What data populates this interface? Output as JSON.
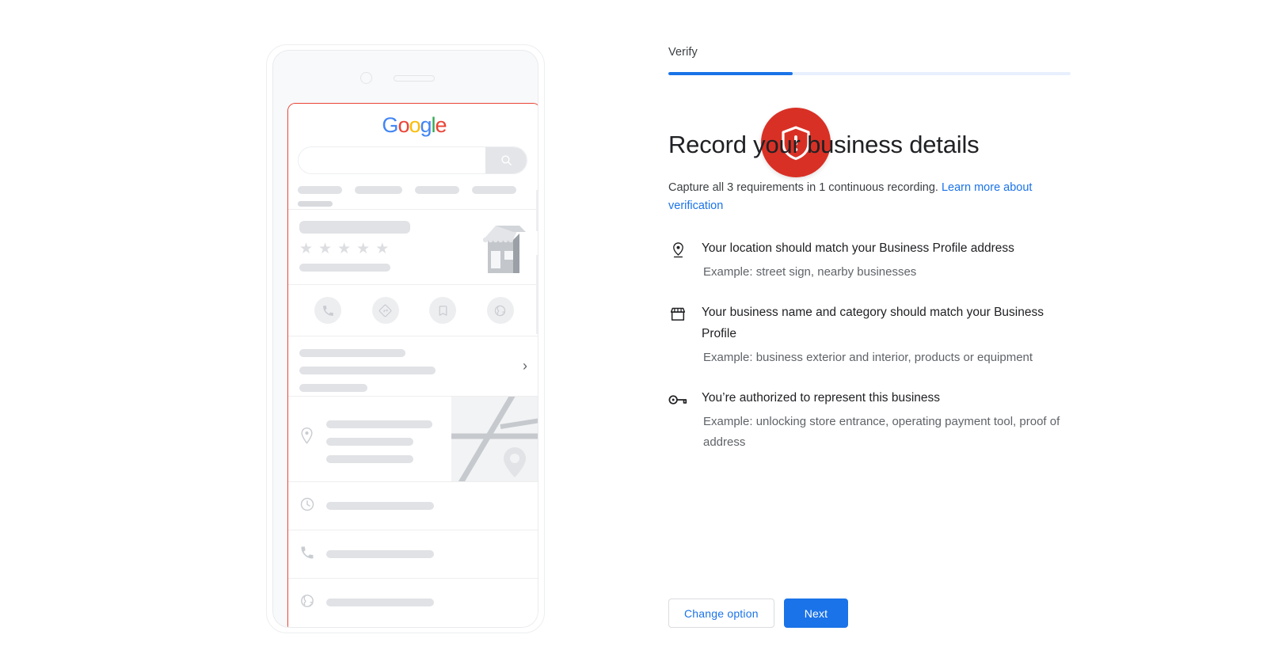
{
  "stepper": {
    "current_step_label": "Verify",
    "progress_percent": 31,
    "fill_color": "#1a73e8",
    "track_color": "#e8f0fe"
  },
  "main": {
    "title": "Record your business details",
    "subtitle_text": "Capture all 3 requirements in 1 continuous recording.",
    "subtitle_link": "Learn more about verification",
    "link_color": "#1a73e8"
  },
  "requirements": [
    {
      "icon": "location-pin-icon",
      "title": "Your location should match your Business Profile address",
      "example": "Example: street sign, nearby businesses"
    },
    {
      "icon": "storefront-icon",
      "title": "Your business name and category should match your Business Profile",
      "example": "Example: business exterior and interior, products or equipment"
    },
    {
      "icon": "key-icon",
      "title": "You’re authorized to represent this business",
      "example": "Example: unlocking store entrance, operating payment tool, proof of address"
    }
  ],
  "actions": {
    "secondary_label": "Change option",
    "primary_label": "Next",
    "primary_bg": "#1a73e8"
  },
  "illustration": {
    "name": "phone-business-profile-mockup",
    "badge": {
      "name": "shield-alert-icon",
      "background": "#d93025",
      "glyph_color": "#ffffff"
    },
    "screen_highlight_color": "#ea4335",
    "google_logo": {
      "letters": [
        {
          "char": "G",
          "color": "#4285F4"
        },
        {
          "char": "o",
          "color": "#EA4335"
        },
        {
          "char": "o",
          "color": "#FBBC05"
        },
        {
          "char": "g",
          "color": "#4285F4"
        },
        {
          "char": "l",
          "color": "#34A853"
        },
        {
          "char": "e",
          "color": "#EA4335"
        }
      ]
    },
    "search": {
      "icon": "search-icon",
      "value": "",
      "placeholder": ""
    },
    "rating_stars": 5,
    "action_icons": [
      "call-icon",
      "directions-icon",
      "bookmark-icon",
      "website-icon"
    ],
    "detail_rows": [
      {
        "icon": "clock-icon"
      },
      {
        "icon": "phone-icon"
      },
      {
        "icon": "globe-icon"
      }
    ],
    "address_icon": "location-pin-icon",
    "map_pin_icon": "map-pin-icon",
    "chevron_icon": "chevron-right-icon",
    "placeholder_color": "#e0e2e5"
  }
}
